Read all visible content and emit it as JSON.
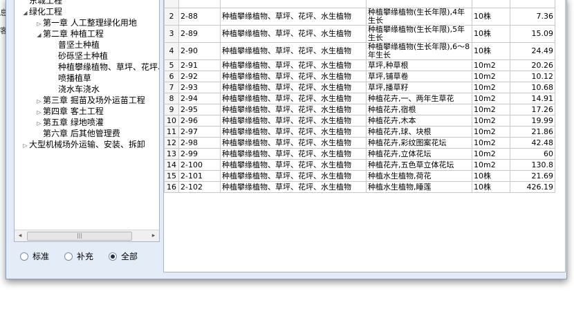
{
  "left_fragments": [
    "息",
    "客"
  ],
  "tree": {
    "items": [
      {
        "label": "东城工程",
        "level": 1,
        "toggle": ""
      },
      {
        "label": "绿化工程",
        "level": 1,
        "toggle": "◢"
      },
      {
        "label": "第一章  人工整理绿化用地",
        "level": 2,
        "toggle": "▷"
      },
      {
        "label": "第二章  种植工程",
        "level": 2,
        "toggle": "◢"
      },
      {
        "label": "普坚土种植",
        "level": 3,
        "toggle": ""
      },
      {
        "label": "砂砾坚土种植",
        "level": 3,
        "toggle": ""
      },
      {
        "label": "种植攀缘植物、草坪、花坪、水生植物",
        "level": 3,
        "toggle": ""
      },
      {
        "label": "喷播植草",
        "level": 3,
        "toggle": ""
      },
      {
        "label": "浇水车浇水",
        "level": 3,
        "toggle": ""
      },
      {
        "label": "第三章  掘苗及场外运苗工程",
        "level": 2,
        "toggle": "▷"
      },
      {
        "label": "第四章  客土工程",
        "level": 2,
        "toggle": "▷"
      },
      {
        "label": "第五章  绿地喷灌",
        "level": 2,
        "toggle": "▷"
      },
      {
        "label": "第六章  后其他管理费",
        "level": 2,
        "toggle": ""
      },
      {
        "label": "大型机械场外运输、安装、拆卸",
        "level": 1,
        "toggle": "▷"
      }
    ],
    "scroll_arrows": {
      "left": "◂",
      "right": "▸",
      "grip": "|||"
    }
  },
  "filter": {
    "options": [
      {
        "label": "标准",
        "checked": false
      },
      {
        "label": "补充",
        "checked": false
      },
      {
        "label": "全部",
        "checked": true
      }
    ]
  },
  "table": {
    "rows": [
      {
        "idx": "",
        "code": "",
        "cat": "",
        "name": "",
        "unit": "",
        "price": ""
      },
      {
        "idx": "2",
        "code": "2-88",
        "cat": "种植攀缘植物、草坪、花坪、水生植物",
        "name": "种植攀缘植物(生长年限),4年生长",
        "unit": "10株",
        "price": "7.36"
      },
      {
        "idx": "3",
        "code": "2-89",
        "cat": "种植攀缘植物、草坪、花坪、水生植物",
        "name": "种植攀缘植物(生长年限),5年生长",
        "unit": "10株",
        "price": "15.09"
      },
      {
        "idx": "4",
        "code": "2-90",
        "cat": "种植攀缘植物、草坪、花坪、水生植物",
        "name": "种植攀缘植物(生长年限),6～8年生长",
        "unit": "10株",
        "price": "24.49"
      },
      {
        "idx": "5",
        "code": "2-91",
        "cat": "种植攀缘植物、草坪、花坪、水生植物",
        "name": "草坪,种草根",
        "unit": "10m2",
        "price": "20.26"
      },
      {
        "idx": "6",
        "code": "2-92",
        "cat": "种植攀缘植物、草坪、花坪、水生植物",
        "name": "草坪,铺草卷",
        "unit": "10m2",
        "price": "10.12"
      },
      {
        "idx": "7",
        "code": "2-93",
        "cat": "种植攀缘植物、草坪、花坪、水生植物",
        "name": "草坪,播草籽",
        "unit": "10m2",
        "price": "10.68"
      },
      {
        "idx": "8",
        "code": "2-94",
        "cat": "种植攀缘植物、草坪、花坪、水生植物",
        "name": "种植花卉,一、两年生草花",
        "unit": "10m2",
        "price": "14.91"
      },
      {
        "idx": "9",
        "code": "2-95",
        "cat": "种植攀缘植物、草坪、花坪、水生植物",
        "name": "种植花卉,宿根",
        "unit": "10m2",
        "price": "17.26"
      },
      {
        "idx": "10",
        "code": "2-96",
        "cat": "种植攀缘植物、草坪、花坪、水生植物",
        "name": "种植花卉,木本",
        "unit": "10m2",
        "price": "19.99"
      },
      {
        "idx": "11",
        "code": "2-97",
        "cat": "种植攀缘植物、草坪、花坪、水生植物",
        "name": "种植花卉,球、块根",
        "unit": "10m2",
        "price": "21.86"
      },
      {
        "idx": "12",
        "code": "2-98",
        "cat": "种植攀缘植物、草坪、花坪、水生植物",
        "name": "种植花卉,彩纹图案花坛",
        "unit": "10m2",
        "price": "42.48"
      },
      {
        "idx": "13",
        "code": "2-99",
        "cat": "种植攀缘植物、草坪、花坪、水生植物",
        "name": "种植花卉,立体花坛",
        "unit": "10m2",
        "price": "60"
      },
      {
        "idx": "14",
        "code": "2-100",
        "cat": "种植攀缘植物、草坪、花坪、水生植物",
        "name": "种植花卉,五色草立体花坛",
        "unit": "10m2",
        "price": "130.8"
      },
      {
        "idx": "15",
        "code": "2-101",
        "cat": "种植攀缘植物、草坪、花坪、水生植物",
        "name": "种植水生植物,荷花",
        "unit": "10株",
        "price": "21.69"
      },
      {
        "idx": "16",
        "code": "2-102",
        "cat": "种植攀缘植物、草坪、花坪、水生植物",
        "name": "种植水生植物,睡莲",
        "unit": "10株",
        "price": "426.19"
      }
    ]
  }
}
